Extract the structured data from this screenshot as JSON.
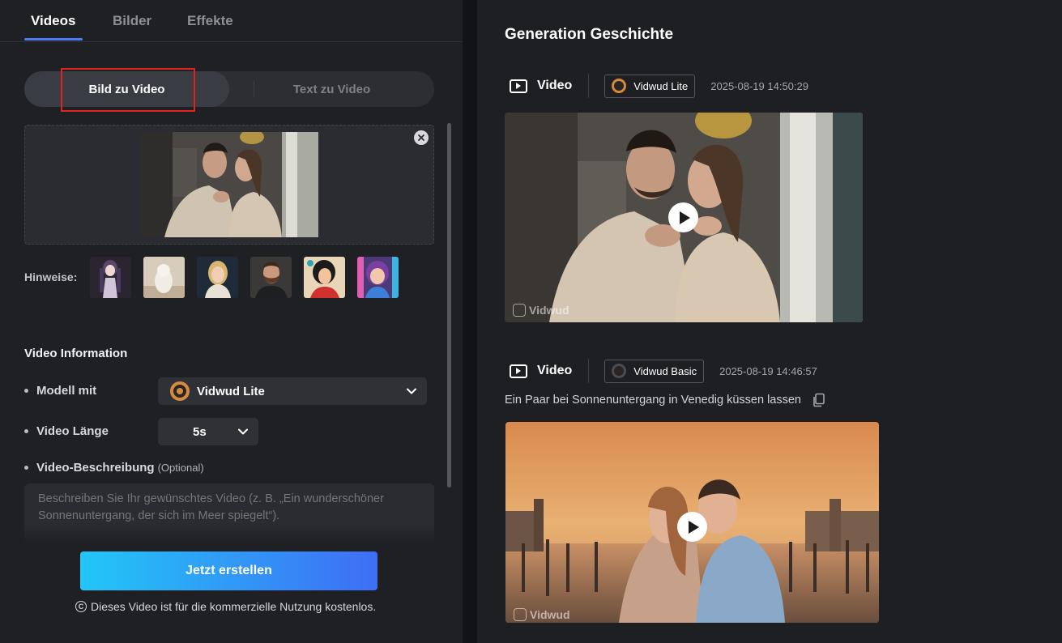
{
  "tabs": [
    {
      "label": "Videos",
      "active": true
    },
    {
      "label": "Bilder",
      "active": false
    },
    {
      "label": "Effekte",
      "active": false
    }
  ],
  "mode": {
    "active": "Bild zu Video",
    "inactive": "Text zu Video"
  },
  "hints": {
    "label": "Hinweise:",
    "thumbnails": [
      "anime-girl",
      "white-dog",
      "blonde-woman",
      "bearded-man",
      "comic-woman",
      "cartoon-girl"
    ]
  },
  "video_info": {
    "title": "Video Information",
    "model_label": "Modell mit",
    "model_value": "Vidwud Lite",
    "length_label": "Video Länge",
    "length_value": "5s",
    "description_label": "Video-Beschreibung",
    "description_optional": "(Optional)",
    "description_placeholder": "Beschreiben Sie Ihr gewünschtes Video (z. B. „Ein wunderschöner Sonnenuntergang, der sich im Meer spiegelt“)."
  },
  "create_button": "Jetzt erstellen",
  "footnote": "Dieses Video ist für die kommerzielle Nutzung kostenlos.",
  "history": {
    "title": "Generation Geschichte",
    "entries": [
      {
        "type": "Video",
        "model": "Vidwud Lite",
        "timestamp": "2025-08-19 14:50:29",
        "prompt": "",
        "watermark": "Vidwud"
      },
      {
        "type": "Video",
        "model": "Vidwud Basic",
        "timestamp": "2025-08-19 14:46:57",
        "prompt": "Ein Paar bei Sonnenuntergang in Venedig küssen lassen",
        "watermark": "Vidwud"
      }
    ]
  },
  "colors": {
    "accent": "#4e7cf5",
    "highlight_border": "#e0241c",
    "button_gradient_start": "#22c6f7",
    "button_gradient_end": "#3e6ef5"
  }
}
